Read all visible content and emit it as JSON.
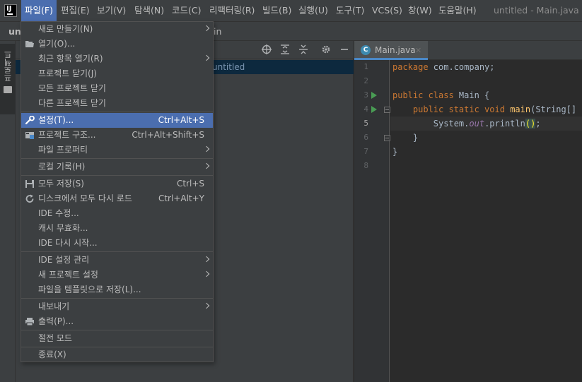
{
  "menubar": {
    "items": [
      "파일(F)",
      "편집(E)",
      "보기(V)",
      "탐색(N)",
      "코드(C)",
      "리팩터링(R)",
      "빌드(B)",
      "실행(U)",
      "도구(T)",
      "VCS(S)",
      "창(W)",
      "도움말(H)"
    ],
    "active_index": 0,
    "window_title": "untitled - Main.java",
    "logo_text": "IJ"
  },
  "navbar": {
    "project_crumb": "unt",
    "file_crumb": "in"
  },
  "toolstrip": {
    "project_tab_label": "프로젝트"
  },
  "project_panel": {
    "tree_root": "untitled"
  },
  "editor": {
    "tab_label": "Main.java",
    "tab_icon_letter": "C",
    "line_numbers": [
      "1",
      "2",
      "3",
      "4",
      "5",
      "6",
      "7",
      "8"
    ],
    "current_line": 5,
    "code": {
      "l1_kw": "package",
      "l1_rest": " com.company;",
      "l3_kw": "public class",
      "l3_rest": " Main {",
      "l4_kw": "public static void",
      "l4_fn": "main",
      "l4_rest": "(String[] ar",
      "l5_obj": "System.",
      "l5_field": "out",
      "l5_method": ".println",
      "l5_parens": "()",
      "l5_end": ";",
      "l6": "}",
      "l7": "}"
    }
  },
  "file_menu": {
    "items": [
      {
        "label": "새로 만들기(N)",
        "shortcut": "",
        "submenu": true,
        "icon": ""
      },
      {
        "label": "열기(O)...",
        "shortcut": "",
        "submenu": false,
        "icon": "folder-icon"
      },
      {
        "label": "최근 항목 열기(R)",
        "shortcut": "",
        "submenu": true,
        "icon": ""
      },
      {
        "label": "프로젝트 닫기(J)",
        "shortcut": "",
        "submenu": false,
        "icon": ""
      },
      {
        "label": "모든 프로젝트 닫기",
        "shortcut": "",
        "submenu": false,
        "icon": ""
      },
      {
        "label": "다른 프로젝트 닫기",
        "shortcut": "",
        "submenu": false,
        "icon": ""
      },
      {
        "label": "설정(T)...",
        "shortcut": "Ctrl+Alt+S",
        "submenu": false,
        "icon": "wrench-icon"
      },
      {
        "label": "프로젝트 구조...",
        "shortcut": "Ctrl+Alt+Shift+S",
        "submenu": false,
        "icon": "project-structure-icon"
      },
      {
        "label": "파일 프로퍼티",
        "shortcut": "",
        "submenu": true,
        "icon": ""
      },
      {
        "label": "로컬 기록(H)",
        "shortcut": "",
        "submenu": true,
        "icon": ""
      },
      {
        "label": "모두 저장(S)",
        "shortcut": "Ctrl+S",
        "submenu": false,
        "icon": "save-icon"
      },
      {
        "label": "디스크에서 모두 다시 로드",
        "shortcut": "Ctrl+Alt+Y",
        "submenu": false,
        "icon": "reload-icon"
      },
      {
        "label": "IDE 수정...",
        "shortcut": "",
        "submenu": false,
        "icon": ""
      },
      {
        "label": "캐시 무효화...",
        "shortcut": "",
        "submenu": false,
        "icon": ""
      },
      {
        "label": "IDE 다시 시작...",
        "shortcut": "",
        "submenu": false,
        "icon": ""
      },
      {
        "label": "IDE 설정 관리",
        "shortcut": "",
        "submenu": true,
        "icon": ""
      },
      {
        "label": "새 프로젝트 설정",
        "shortcut": "",
        "submenu": true,
        "icon": ""
      },
      {
        "label": "파일을 템플릿으로 저장(L)...",
        "shortcut": "",
        "submenu": false,
        "icon": ""
      },
      {
        "label": "내보내기",
        "shortcut": "",
        "submenu": true,
        "icon": ""
      },
      {
        "label": "출력(P)...",
        "shortcut": "",
        "submenu": false,
        "icon": "print-icon"
      },
      {
        "label": "절전 모드",
        "shortcut": "",
        "submenu": false,
        "icon": ""
      },
      {
        "label": "종료(X)",
        "shortcut": "",
        "submenu": false,
        "icon": ""
      }
    ],
    "highlighted_index": 6
  },
  "colors": {
    "accent": "#4b6eaf",
    "background": "#2b2b2b",
    "panel": "#3c3f41",
    "keyword": "#cc7832",
    "function": "#ffc66d",
    "field": "#9876aa",
    "run_icon": "#499c54"
  }
}
